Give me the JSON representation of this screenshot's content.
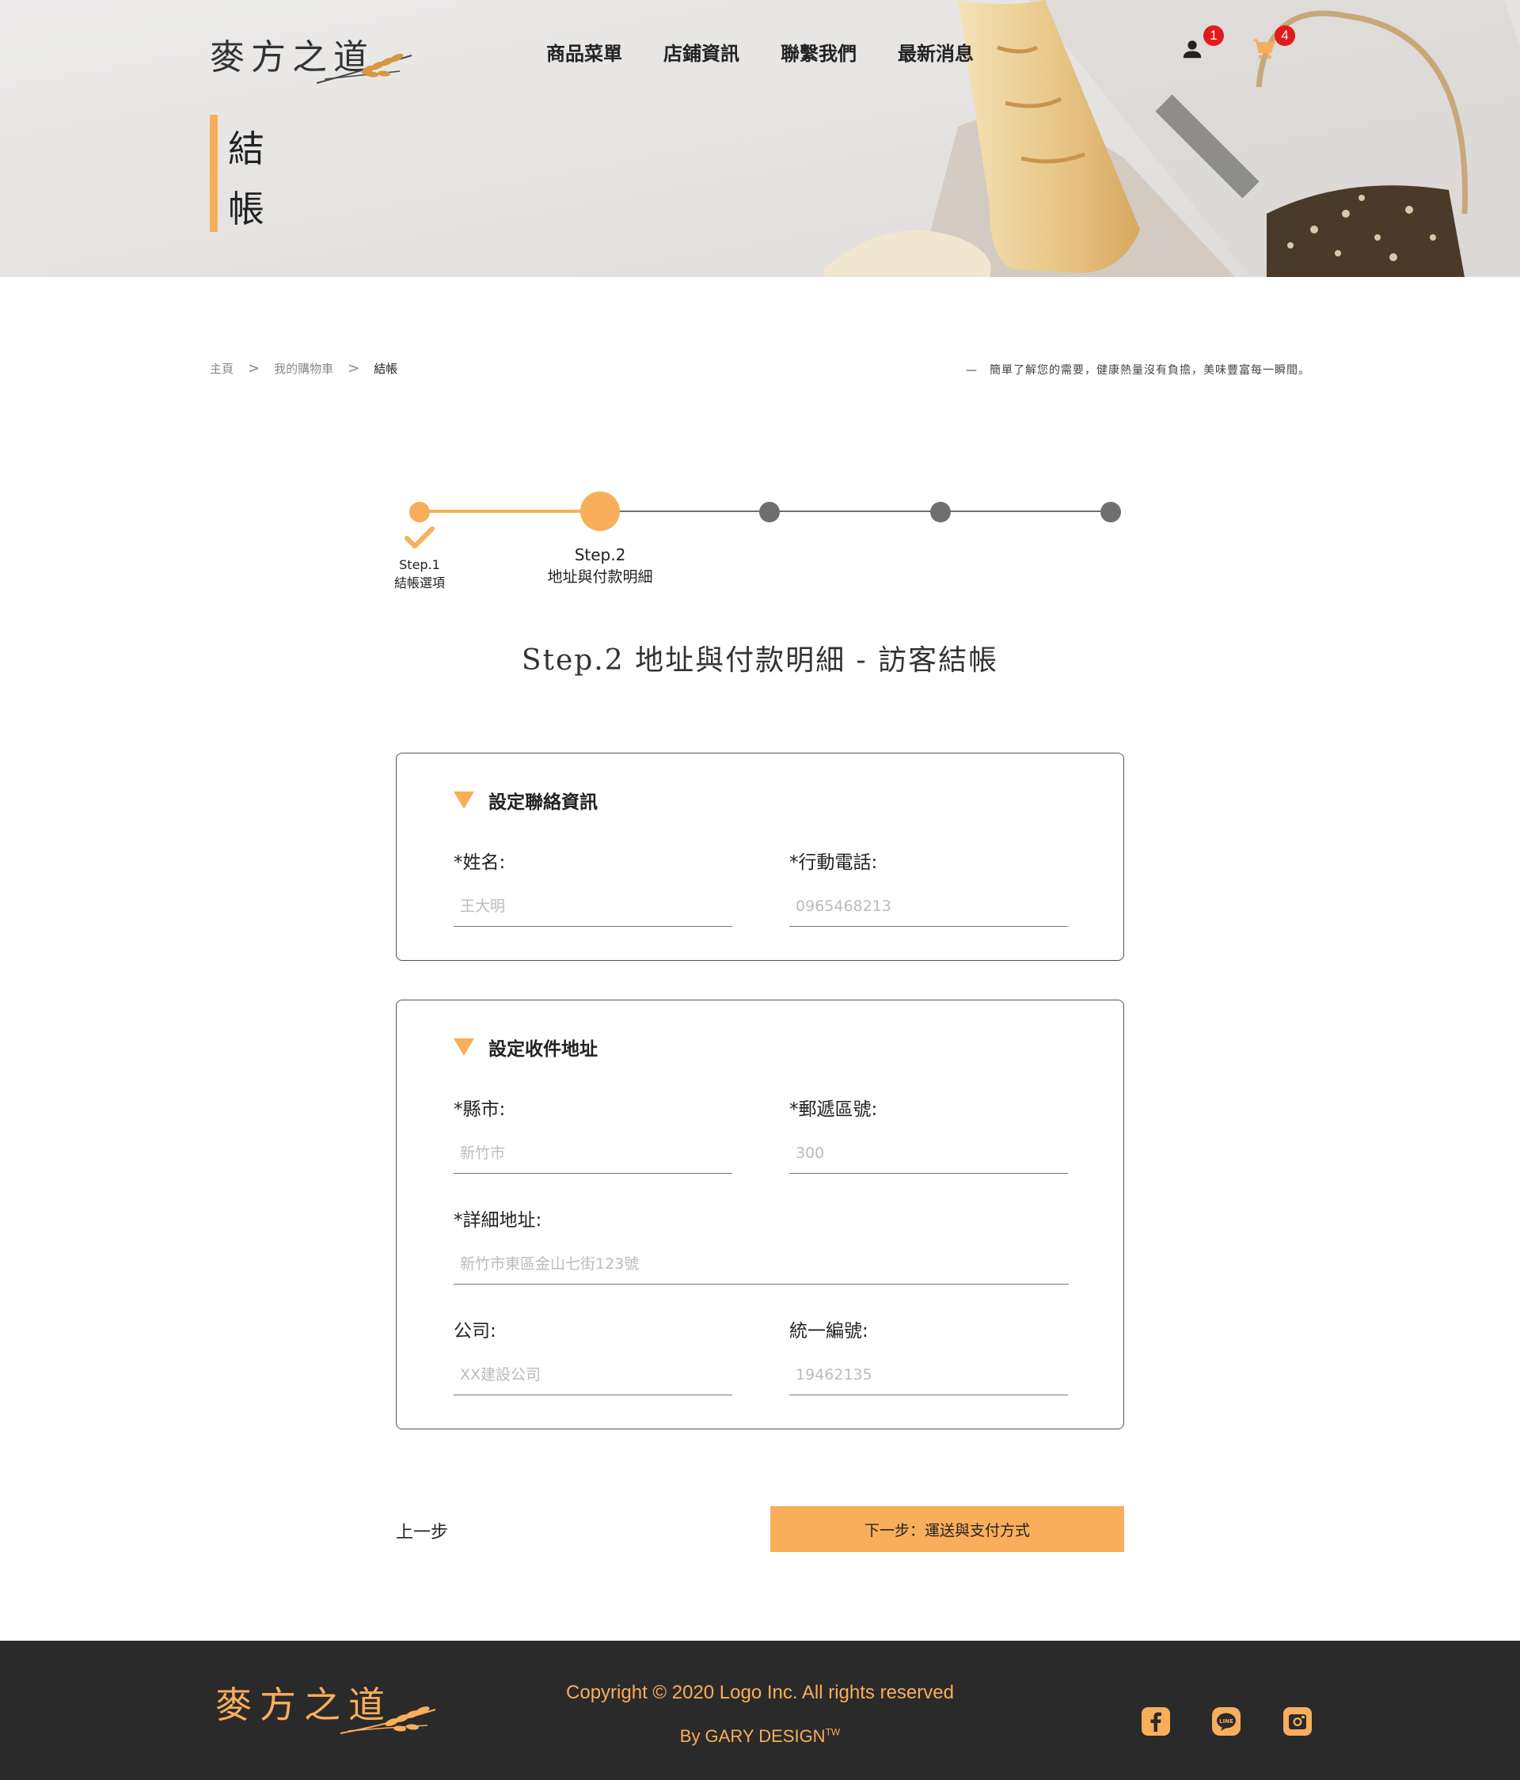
{
  "header": {
    "logo_text": "麥方之道",
    "nav": [
      "商品菜單",
      "店鋪資訊",
      "聯繫我們",
      "最新消息"
    ],
    "user_badge": "1",
    "cart_badge": "4",
    "page_title": "結帳"
  },
  "breadcrumb": {
    "home": "主頁",
    "sep": ">",
    "cart": "我的購物車",
    "current": "結帳"
  },
  "slogan": "—　簡單了解您的需要，健康熱量沒有負擔，美味豐富每一瞬間。",
  "stepper": {
    "step1_title": "Step.1",
    "step1_sub": "結帳選項",
    "step2_title": "Step.2",
    "step2_sub": "地址與付款明細",
    "current_step": 2,
    "total_steps": 5
  },
  "section_title": "Step.2 地址與付款明細 - 訪客結帳",
  "contact": {
    "heading": "設定聯絡資訊",
    "name_label": "*姓名:",
    "name_placeholder": "王大明",
    "phone_label": "*行動電話:",
    "phone_placeholder": "0965468213"
  },
  "address": {
    "heading": "設定收件地址",
    "city_label": "*縣市:",
    "city_placeholder": "新竹市",
    "zip_label": "*郵遞區號:",
    "zip_placeholder": "300",
    "detail_label": "*詳細地址:",
    "detail_placeholder": "新竹市東區金山七街123號",
    "company_label": "公司:",
    "company_placeholder": "XX建設公司",
    "taxid_label": "統一編號:",
    "taxid_placeholder": "19462135"
  },
  "actions": {
    "prev": "上一步",
    "next": "下一步：運送與支付方式"
  },
  "footer": {
    "logo_text": "麥方之道",
    "copyright": "Copyright © 2020 Logo Inc. All rights reserved",
    "byline": "By GARY DESIGN",
    "trademark": "TW",
    "social": [
      "facebook-icon",
      "line-icon",
      "instagram-icon"
    ]
  },
  "colors": {
    "accent": "#f9ae5c",
    "badge": "#e01b1b",
    "footer_bg": "#2a2a2a"
  }
}
